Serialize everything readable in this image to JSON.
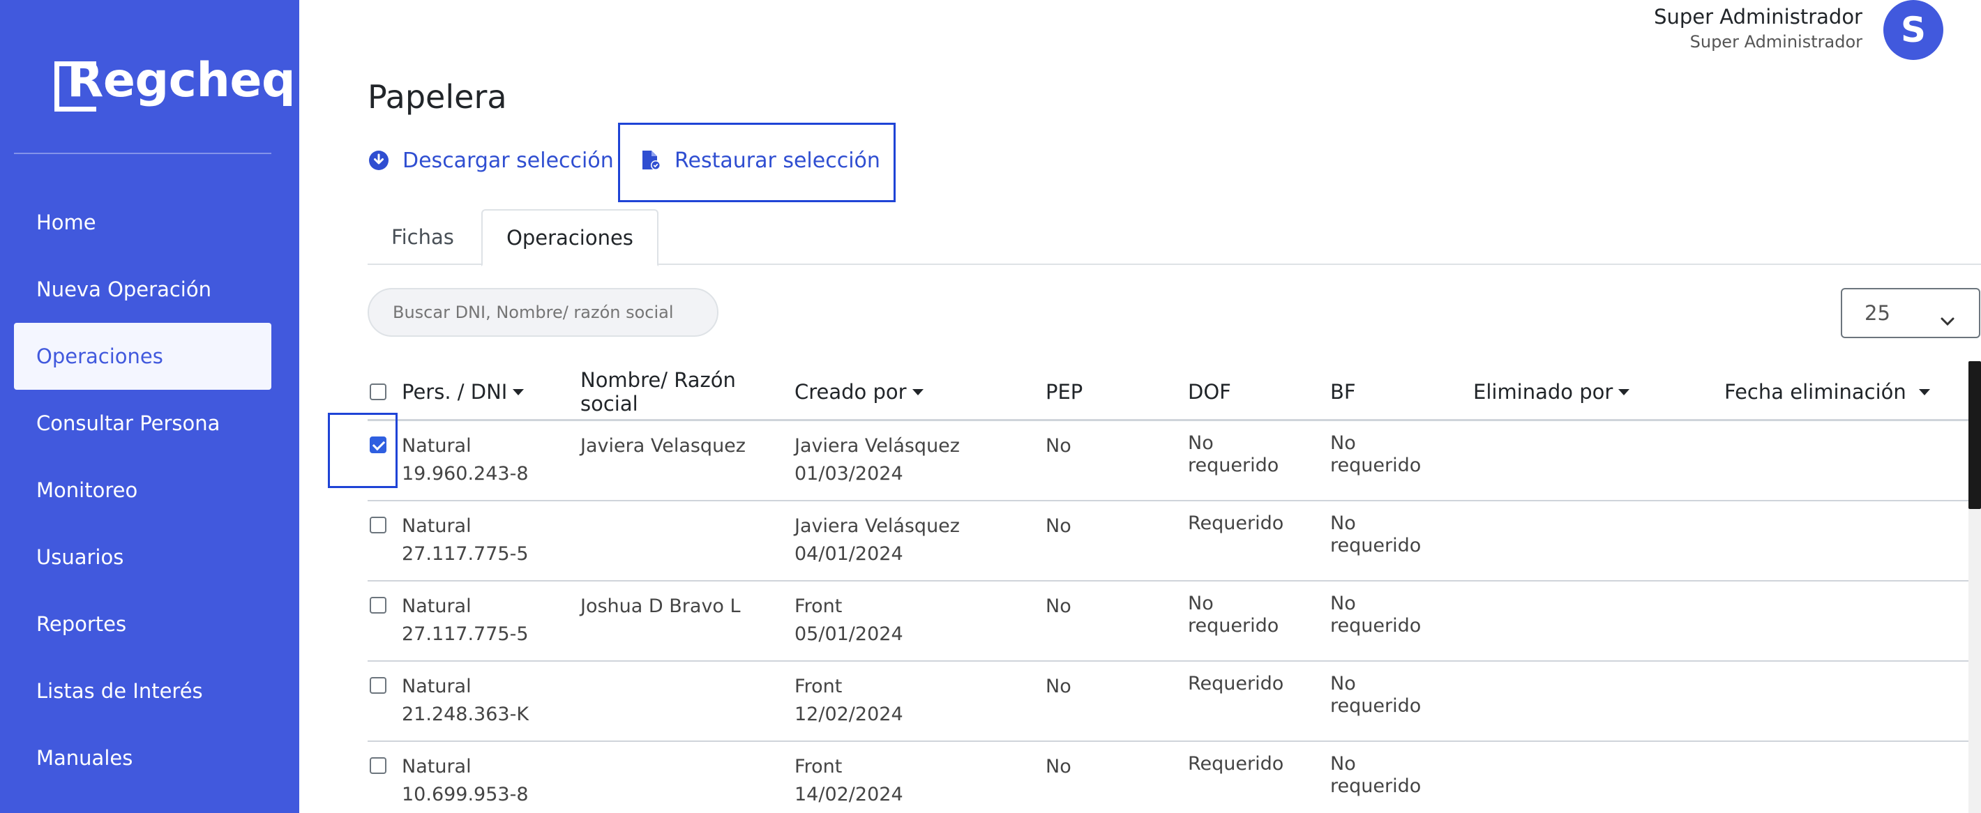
{
  "brand": {
    "logo_text": "Regcheq"
  },
  "sidebar": {
    "items": [
      {
        "label": "Home"
      },
      {
        "label": "Nueva Operación"
      },
      {
        "label": "Operaciones",
        "active": true
      },
      {
        "label": "Consultar Persona"
      },
      {
        "label": "Monitoreo"
      },
      {
        "label": "Usuarios"
      },
      {
        "label": "Reportes"
      },
      {
        "label": "Listas de Interés"
      },
      {
        "label": "Manuales"
      }
    ]
  },
  "user": {
    "name": "Super Administrador",
    "role": "Super Administrador",
    "avatar_initial": "S"
  },
  "page": {
    "title": "Papelera"
  },
  "actions": {
    "download_label": "Descargar selección",
    "restore_label": "Restaurar selección"
  },
  "tabs": [
    {
      "label": "Fichas"
    },
    {
      "label": "Operaciones",
      "active": true
    }
  ],
  "search": {
    "placeholder": "Buscar DNI, Nombre/ razón social",
    "value": ""
  },
  "page_size": {
    "value": "25"
  },
  "table": {
    "headers": {
      "pers": "Pers. / DNI",
      "nombre_1": "Nombre/ Razón",
      "nombre_2": "social",
      "creado": "Creado por",
      "pep": "PEP",
      "dof": "DOF",
      "bf": "BF",
      "eliminado": "Eliminado por",
      "fecha": "Fecha eliminación"
    },
    "rows": [
      {
        "checked": true,
        "tipo": "Natural",
        "dni": "19.960.243-8",
        "nombre": "Javiera Velasquez",
        "creado_por": "Javiera Velásquez",
        "fecha_creacion": "01/03/2024",
        "pep": "No",
        "dof_1": "No",
        "dof_2": "requerido",
        "bf_1": "No",
        "bf_2": "requerido"
      },
      {
        "checked": false,
        "tipo": "Natural",
        "dni": "27.117.775-5",
        "nombre": "",
        "creado_por": "Javiera Velásquez",
        "fecha_creacion": "04/01/2024",
        "pep": "No",
        "dof_1": "Requerido",
        "dof_2": "",
        "bf_1": "No",
        "bf_2": "requerido"
      },
      {
        "checked": false,
        "tipo": "Natural",
        "dni": "27.117.775-5",
        "nombre": "Joshua D Bravo L",
        "creado_por": "Front",
        "fecha_creacion": "05/01/2024",
        "pep": "No",
        "dof_1": "No",
        "dof_2": "requerido",
        "bf_1": "No",
        "bf_2": "requerido"
      },
      {
        "checked": false,
        "tipo": "Natural",
        "dni": "21.248.363-K",
        "nombre": "",
        "creado_por": "Front",
        "fecha_creacion": "12/02/2024",
        "pep": "No",
        "dof_1": "Requerido",
        "dof_2": "",
        "bf_1": "No",
        "bf_2": "requerido"
      },
      {
        "checked": false,
        "tipo": "Natural",
        "dni": "10.699.953-8",
        "nombre": "",
        "creado_por": "Front",
        "fecha_creacion": "14/02/2024",
        "pep": "No",
        "dof_1": "Requerido",
        "dof_2": "",
        "bf_1": "No",
        "bf_2": "requerido"
      }
    ]
  },
  "colors": {
    "sidebar": "#4159dd",
    "accent": "#2f4ed1",
    "highlight": "#1f44d6"
  }
}
